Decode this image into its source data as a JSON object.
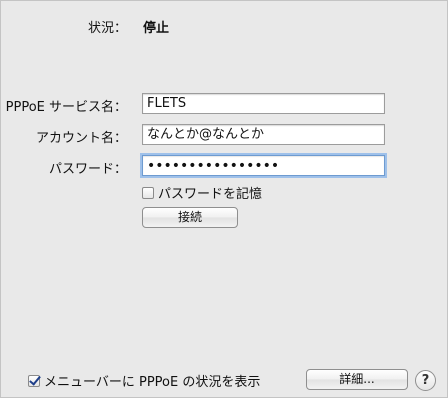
{
  "status": {
    "label": "状況：",
    "value": "停止"
  },
  "pppoe_service": {
    "label": "PPPoE サービス名：",
    "value": "FLETS"
  },
  "account": {
    "label": "アカウント名：",
    "value": "なんとか@なんとか"
  },
  "password": {
    "label": "パスワード：",
    "value": "••••••••••••••••"
  },
  "remember_password": {
    "label": "パスワードを記憶",
    "checked": false
  },
  "connect_button": {
    "label": "接続"
  },
  "menubar_option": {
    "label": "メニューバーに PPPoE の状況を表示",
    "checked": true
  },
  "details_button": {
    "label": "詳細..."
  },
  "help_button": {
    "label": "?"
  }
}
